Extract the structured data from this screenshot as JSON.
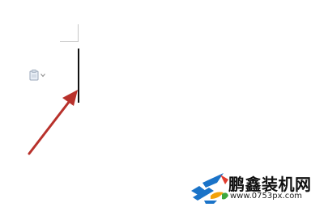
{
  "document": {
    "paste_options_icon": "clipboard-paste-icon",
    "dropdown_icon": "chevron-down-icon"
  },
  "annotation": {
    "arrow_color": "#b8312b"
  },
  "watermark": {
    "title": "鹏鑫装机网",
    "url": "www.0753px.com",
    "logo_colors": [
      "#1a73c8",
      "#f2a20b",
      "#3fa83f",
      "#e23b2e"
    ]
  }
}
